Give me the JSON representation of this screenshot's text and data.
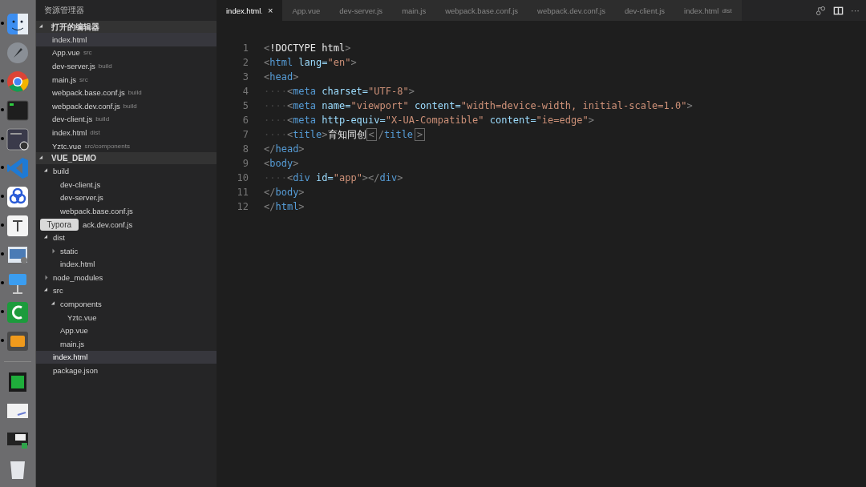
{
  "dock": [
    {
      "kind": "finder",
      "running": true
    },
    {
      "kind": "launchpad",
      "running": false
    },
    {
      "kind": "chrome",
      "running": true
    },
    {
      "kind": "terminal",
      "running": true
    },
    {
      "kind": "recorder",
      "running": true
    },
    {
      "kind": "vscode",
      "running": true
    },
    {
      "kind": "cloud",
      "running": true
    },
    {
      "kind": "typora",
      "running": true,
      "tooltip": "Typora"
    },
    {
      "kind": "preview",
      "running": true
    },
    {
      "kind": "keynote",
      "running": true
    },
    {
      "kind": "camtasia",
      "running": true
    },
    {
      "kind": "sublime",
      "running": true
    },
    {
      "kind": "separator"
    },
    {
      "kind": "film",
      "running": false
    },
    {
      "kind": "note",
      "running": false
    },
    {
      "kind": "screen",
      "running": false
    },
    {
      "kind": "trash",
      "running": false
    }
  ],
  "sidebar": {
    "title": "资源管理器",
    "open_editors": {
      "label": "打开的编辑器",
      "expanded": true,
      "items": [
        {
          "name": "index.html",
          "selected": true
        },
        {
          "name": "App.vue",
          "detail": "src",
          "selected": false
        },
        {
          "name": "dev-server.js",
          "detail": "build",
          "selected": false
        },
        {
          "name": "main.js",
          "detail": "src",
          "selected": false
        },
        {
          "name": "webpack.base.conf.js",
          "detail": "build",
          "selected": false
        },
        {
          "name": "webpack.dev.conf.js",
          "detail": "build",
          "selected": false
        },
        {
          "name": "dev-client.js",
          "detail": "build",
          "selected": false
        },
        {
          "name": "index.html",
          "detail": "dist",
          "selected": false
        },
        {
          "name": "Yztc.vue",
          "detail": "src/components",
          "selected": false
        }
      ]
    },
    "project": {
      "label": "VUE_DEMO",
      "expanded": true,
      "tree": [
        {
          "name": "build",
          "expanded": true,
          "selected": false,
          "children": [
            {
              "name": "dev-client.js",
              "selected": false
            },
            {
              "name": "dev-server.js",
              "selected": false
            },
            {
              "name": "webpack.base.conf.js",
              "selected": false
            },
            {
              "name": "ack.dev.conf.js",
              "selected": false,
              "covered": true
            }
          ]
        },
        {
          "name": "dist",
          "expanded": true,
          "selected": false,
          "children": [
            {
              "name": "static",
              "expanded": false,
              "selected": false
            },
            {
              "name": "index.html",
              "selected": false
            }
          ]
        },
        {
          "name": "node_modules",
          "expanded": false,
          "selected": false
        },
        {
          "name": "src",
          "expanded": true,
          "selected": false,
          "children": [
            {
              "name": "components",
              "expanded": true,
              "selected": false,
              "children": [
                {
                  "name": "Yztc.vue",
                  "selected": false
                }
              ]
            },
            {
              "name": "App.vue",
              "selected": false
            },
            {
              "name": "main.js",
              "selected": false
            }
          ]
        },
        {
          "name": "index.html",
          "selected": true
        },
        {
          "name": "package.json",
          "selected": false
        }
      ]
    }
  },
  "tabs": [
    {
      "label": "index.html",
      "selected": true,
      "modified": ".",
      "close": "×"
    },
    {
      "label": "App.vue",
      "selected": false
    },
    {
      "label": "dev-server.js",
      "selected": false
    },
    {
      "label": "main.js",
      "selected": false
    },
    {
      "label": "webpack.base.conf.js",
      "selected": false
    },
    {
      "label": "webpack.dev.conf.js",
      "selected": false
    },
    {
      "label": "dev-client.js",
      "selected": false
    },
    {
      "label": "index.html",
      "detail": "dist",
      "selected": false
    }
  ],
  "tab_actions": [
    {
      "kind": "compare"
    },
    {
      "kind": "split"
    },
    {
      "kind": "more",
      "label": "···"
    }
  ],
  "editor": {
    "lines": [
      {
        "number": "1",
        "tokens": [
          {
            "kind": "punct",
            "text": "<"
          },
          {
            "kind": "doctype",
            "text": "!DOCTYPE html"
          },
          {
            "kind": "punct",
            "text": ">"
          }
        ]
      },
      {
        "number": "2",
        "tokens": [
          {
            "kind": "punct",
            "text": "<"
          },
          {
            "kind": "tag",
            "text": "html"
          },
          {
            "kind": "attr",
            "text": " lang="
          },
          {
            "kind": "string",
            "text": "\"en\""
          },
          {
            "kind": "punct",
            "text": ">"
          }
        ]
      },
      {
        "number": "3",
        "tokens": [
          {
            "kind": "punct",
            "text": "<"
          },
          {
            "kind": "tag",
            "text": "head"
          },
          {
            "kind": "punct",
            "text": ">"
          }
        ]
      },
      {
        "number": "4",
        "tokens": [
          {
            "kind": "indent",
            "text": "····"
          },
          {
            "kind": "punct",
            "text": "<"
          },
          {
            "kind": "tag",
            "text": "meta"
          },
          {
            "kind": "attr",
            "text": " charset="
          },
          {
            "kind": "string",
            "text": "\"UTF-8\""
          },
          {
            "kind": "punct",
            "text": ">"
          }
        ]
      },
      {
        "number": "5",
        "tokens": [
          {
            "kind": "indent",
            "text": "····"
          },
          {
            "kind": "punct",
            "text": "<"
          },
          {
            "kind": "tag",
            "text": "meta"
          },
          {
            "kind": "attr",
            "text": " name="
          },
          {
            "kind": "string",
            "text": "\"viewport\""
          },
          {
            "kind": "attr",
            "text": " content="
          },
          {
            "kind": "string",
            "text": "\"width=device-width, initial-scale=1.0\""
          },
          {
            "kind": "punct",
            "text": ">"
          }
        ]
      },
      {
        "number": "6",
        "tokens": [
          {
            "kind": "indent",
            "text": "····"
          },
          {
            "kind": "punct",
            "text": "<"
          },
          {
            "kind": "tag",
            "text": "meta"
          },
          {
            "kind": "attr",
            "text": " http-equiv="
          },
          {
            "kind": "string",
            "text": "\"X-UA-Compatible\""
          },
          {
            "kind": "attr",
            "text": " content="
          },
          {
            "kind": "string",
            "text": "\"ie=edge\""
          },
          {
            "kind": "punct",
            "text": ">"
          }
        ]
      },
      {
        "number": "7",
        "tokens": [
          {
            "kind": "indent",
            "text": "····"
          },
          {
            "kind": "punct",
            "text": "<"
          },
          {
            "kind": "tag",
            "text": "title"
          },
          {
            "kind": "punct",
            "text": ">"
          },
          {
            "kind": "text",
            "text": "育知同创"
          },
          {
            "kind": "cursor",
            "text": "<"
          },
          {
            "kind": "punct",
            "text": "/"
          },
          {
            "kind": "tag",
            "text": "title"
          },
          {
            "kind": "match",
            "text": ">"
          }
        ]
      },
      {
        "number": "8",
        "tokens": [
          {
            "kind": "punct",
            "text": "</"
          },
          {
            "kind": "tag",
            "text": "head"
          },
          {
            "kind": "punct",
            "text": ">"
          }
        ]
      },
      {
        "number": "9",
        "tokens": [
          {
            "kind": "punct",
            "text": "<"
          },
          {
            "kind": "tag",
            "text": "body"
          },
          {
            "kind": "punct",
            "text": ">"
          }
        ]
      },
      {
        "number": "10",
        "tokens": [
          {
            "kind": "indent",
            "text": "····"
          },
          {
            "kind": "punct",
            "text": "<"
          },
          {
            "kind": "tag",
            "text": "div"
          },
          {
            "kind": "attr",
            "text": " id="
          },
          {
            "kind": "string",
            "text": "\"app\""
          },
          {
            "kind": "punct",
            "text": "></"
          },
          {
            "kind": "tag",
            "text": "div"
          },
          {
            "kind": "punct",
            "text": ">"
          }
        ]
      },
      {
        "number": "11",
        "tokens": [
          {
            "kind": "punct",
            "text": "</"
          },
          {
            "kind": "tag",
            "text": "body"
          },
          {
            "kind": "punct",
            "text": ">"
          }
        ]
      },
      {
        "number": "12",
        "tokens": [
          {
            "kind": "punct",
            "text": "</"
          },
          {
            "kind": "tag",
            "text": "html"
          },
          {
            "kind": "punct",
            "text": ">"
          }
        ]
      }
    ]
  }
}
